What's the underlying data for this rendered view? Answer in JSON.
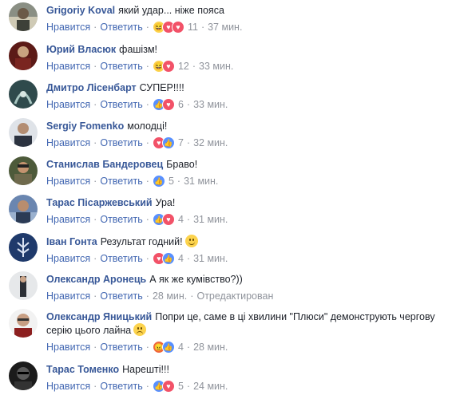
{
  "colors": {
    "author": "#385898",
    "link": "#4267b2",
    "meta": "#90949c",
    "text": "#1d2129"
  },
  "labels": {
    "like": "Нравится",
    "reply": "Ответить",
    "separator": "·"
  },
  "comments": [
    {
      "author": "Grigoriy Koval",
      "text": "який удар... ніже пояса",
      "reactions": [
        "haha",
        "love",
        "love"
      ],
      "count": "11",
      "time": "37 мин."
    },
    {
      "author": "Юрий Власюк",
      "text": "фашізм!",
      "reactions": [
        "haha",
        "love"
      ],
      "count": "12",
      "time": "33 мин."
    },
    {
      "author": "Дмитро Лісенбарт",
      "text": "СУПЕР!!!!",
      "reactions": [
        "like",
        "love"
      ],
      "count": "6",
      "time": "33 мин."
    },
    {
      "author": "Sergiy Fomenko",
      "text": "молодці!",
      "reactions": [
        "love",
        "like"
      ],
      "count": "7",
      "time": "32 мин."
    },
    {
      "author": "Станислав Бандеровец",
      "text": "Браво!",
      "reactions": [
        "like"
      ],
      "count": "5",
      "time": "31 мин."
    },
    {
      "author": "Тарас Пісаржевський",
      "text": "Ура!",
      "reactions": [
        "like",
        "love"
      ],
      "count": "4",
      "time": "31 мин."
    },
    {
      "author": "Іван Гонта",
      "text": "Результат годний!",
      "emoji": "smile",
      "reactions": [
        "love",
        "like"
      ],
      "count": "4",
      "time": "31 мин."
    },
    {
      "author": "Олександр Аронець",
      "text": "А як же кумівство?))",
      "time": "28 мин.",
      "edited": "Отредактирован"
    },
    {
      "author": "Олександр Яницький",
      "text": "Попри це, саме в ці хвилини \"Плюси\" демонструють чергову серію цього лайна",
      "emoji": "sad",
      "reactions": [
        "angry",
        "like"
      ],
      "count": "4",
      "time": "28 мин."
    },
    {
      "author": "Тарас Томенко",
      "text": "Нарешті!!!",
      "reactions": [
        "like",
        "love"
      ],
      "count": "5",
      "time": "24 мин."
    }
  ]
}
